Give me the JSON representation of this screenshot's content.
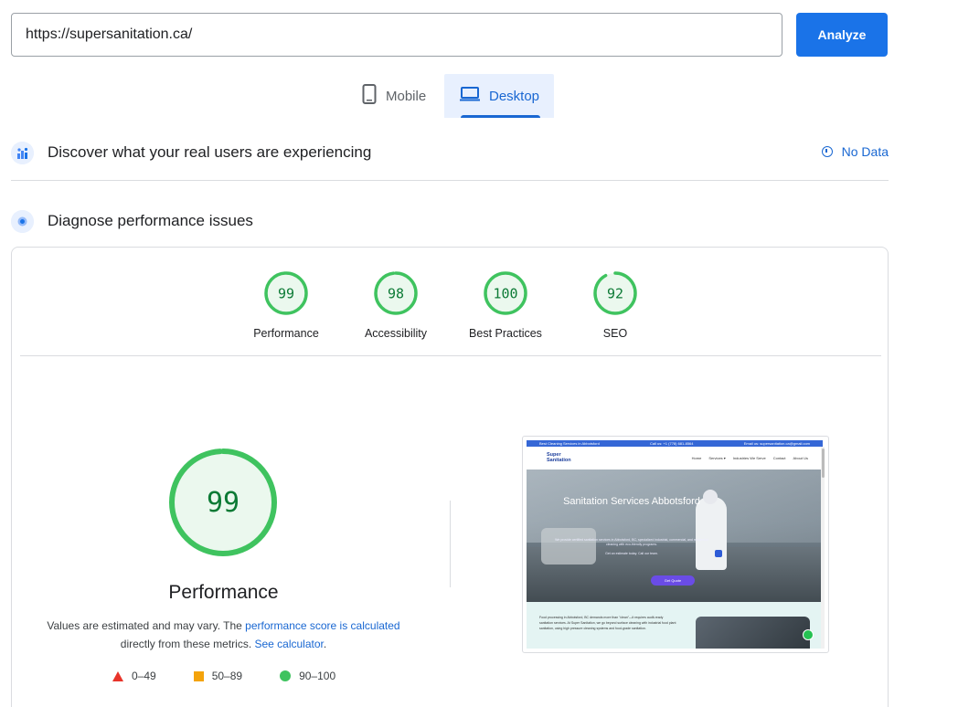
{
  "search": {
    "url_value": "https://supersanitation.ca/",
    "analyze_label": "Analyze"
  },
  "tabs": [
    {
      "label": "Mobile",
      "icon": "phone-icon",
      "selected": false
    },
    {
      "label": "Desktop",
      "icon": "laptop-icon",
      "selected": true
    }
  ],
  "field_data": {
    "title": "Discover what your real users are experiencing",
    "status_label": "No Data"
  },
  "lab": {
    "title": "Diagnose performance issues"
  },
  "categories": [
    {
      "label": "Performance",
      "score": 99
    },
    {
      "label": "Accessibility",
      "score": 98
    },
    {
      "label": "Best Practices",
      "score": 100
    },
    {
      "label": "SEO",
      "score": 92
    }
  ],
  "performance": {
    "score": 99,
    "title": "Performance",
    "note_prefix": "Values are estimated and may vary. The ",
    "note_link": "performance score is calculated",
    "note_mid": " directly from these metrics. ",
    "note_calc_link": "See calculator",
    "note_suffix": "."
  },
  "legend": [
    {
      "shape": "triangle",
      "label": "0–49",
      "color": "#e8342a"
    },
    {
      "shape": "square",
      "label": "50–89",
      "color": "#f4a30b"
    },
    {
      "shape": "circle",
      "label": "90–100",
      "color": "#3fc35f"
    }
  ],
  "colors": {
    "pass": "#0c7a35",
    "pass_ring": "#3fc35f",
    "pass_fill": "#ebf8ee",
    "accent": "#1a73e8"
  },
  "screenshot": {
    "topbar_left": "Best Cleaning Services in Abbotsford",
    "topbar_mid": "Call us: +1 (778) 681-8564",
    "topbar_right": "Email us: supersanitation.ca@gmail.com",
    "logo_line1": "Super",
    "logo_line2": "Sanitation",
    "menu": [
      "Home",
      "Services ▾",
      "Industries We Serve",
      "Contact",
      "About Us"
    ],
    "hero_title": "Sanitation Services Abbotsford",
    "hero_sub": "We provide certified sanitation services in Abbotsford, BC, specialized industrial, commercial, and residential cleaning with eco-friendly programs.",
    "hero_sub2": "Get an estimate today. Call our team.",
    "cta": "Get Quote",
    "lower_text": "Food processing in Abbotsford, BC demands more than \"clean\"—it requires audit-ready sanitation services. At Super Sanitation, we go beyond surface cleaning with industrial food plant sanitation, using high pressure cleaning systems and food-grade sanitation."
  }
}
